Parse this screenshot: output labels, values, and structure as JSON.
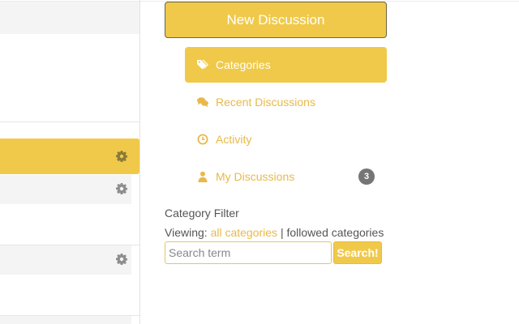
{
  "new_discussion": {
    "label": "New Discussion"
  },
  "nav": {
    "items": [
      {
        "label": "Categories",
        "icon": "tags-icon",
        "active": true
      },
      {
        "label": "Recent Discussions",
        "icon": "comments-icon",
        "active": false
      },
      {
        "label": "Activity",
        "icon": "clock-icon",
        "active": false
      },
      {
        "label": "My Discussions",
        "icon": "user-icon",
        "active": false,
        "badge": "3"
      }
    ]
  },
  "category_filter": {
    "title": "Category Filter",
    "viewing_label": "Viewing:",
    "all_categories": "all categories",
    "separator": "|",
    "followed_categories": "followed categories",
    "search_placeholder": "Search term",
    "search_button": "Search!"
  },
  "colors": {
    "accent": "#f0c94a",
    "link": "#e8b94a",
    "badge": "#757575",
    "text": "#555555"
  }
}
